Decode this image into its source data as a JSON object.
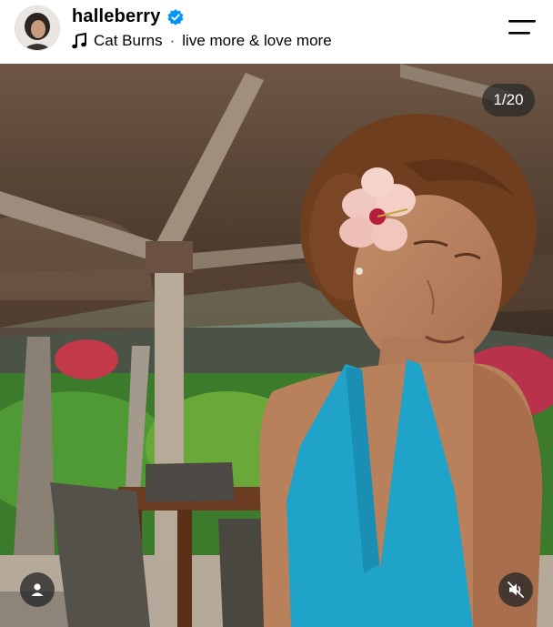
{
  "post": {
    "username": "halleberry",
    "verified": true,
    "audio_artist": "Cat Burns",
    "separator": "·",
    "audio_title": "live more & love more"
  },
  "media": {
    "counter": "1/20"
  },
  "colors": {
    "verified_blue": "#0095f6",
    "overlay_dark": "#282828"
  },
  "icons": {
    "menu": "menu-icon",
    "music": "music-note-icon",
    "verified": "verified-badge-icon",
    "user_tag": "person-icon",
    "mute": "speaker-muted-icon"
  }
}
